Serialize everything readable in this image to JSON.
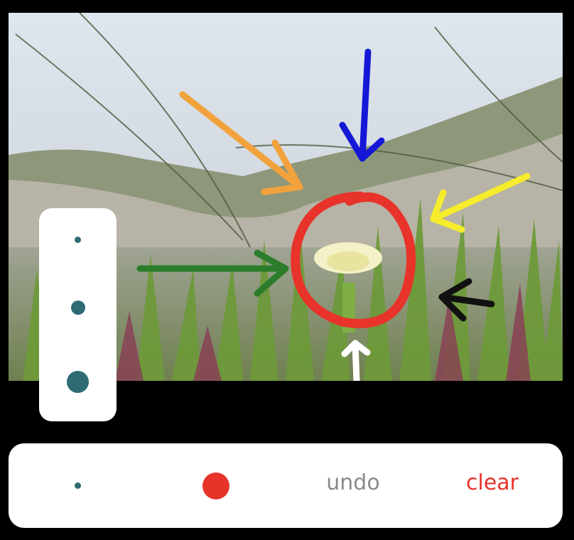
{
  "canvas": {
    "subject": "beach-ice-plant-flower-photo"
  },
  "annotations": {
    "stroke_colors": [
      "#f2a23c",
      "#1418d6",
      "#f5ec2b",
      "#2b7d2b",
      "#111111",
      "#ffffff",
      "#e8332a"
    ]
  },
  "size_panel": {
    "brush_sizes": [
      "small",
      "medium",
      "large"
    ],
    "dot_color": "#2e6b73"
  },
  "toolbar": {
    "current_brush": "small",
    "current_color": "#e8332a",
    "undo_label": "undo",
    "clear_label": "clear"
  }
}
